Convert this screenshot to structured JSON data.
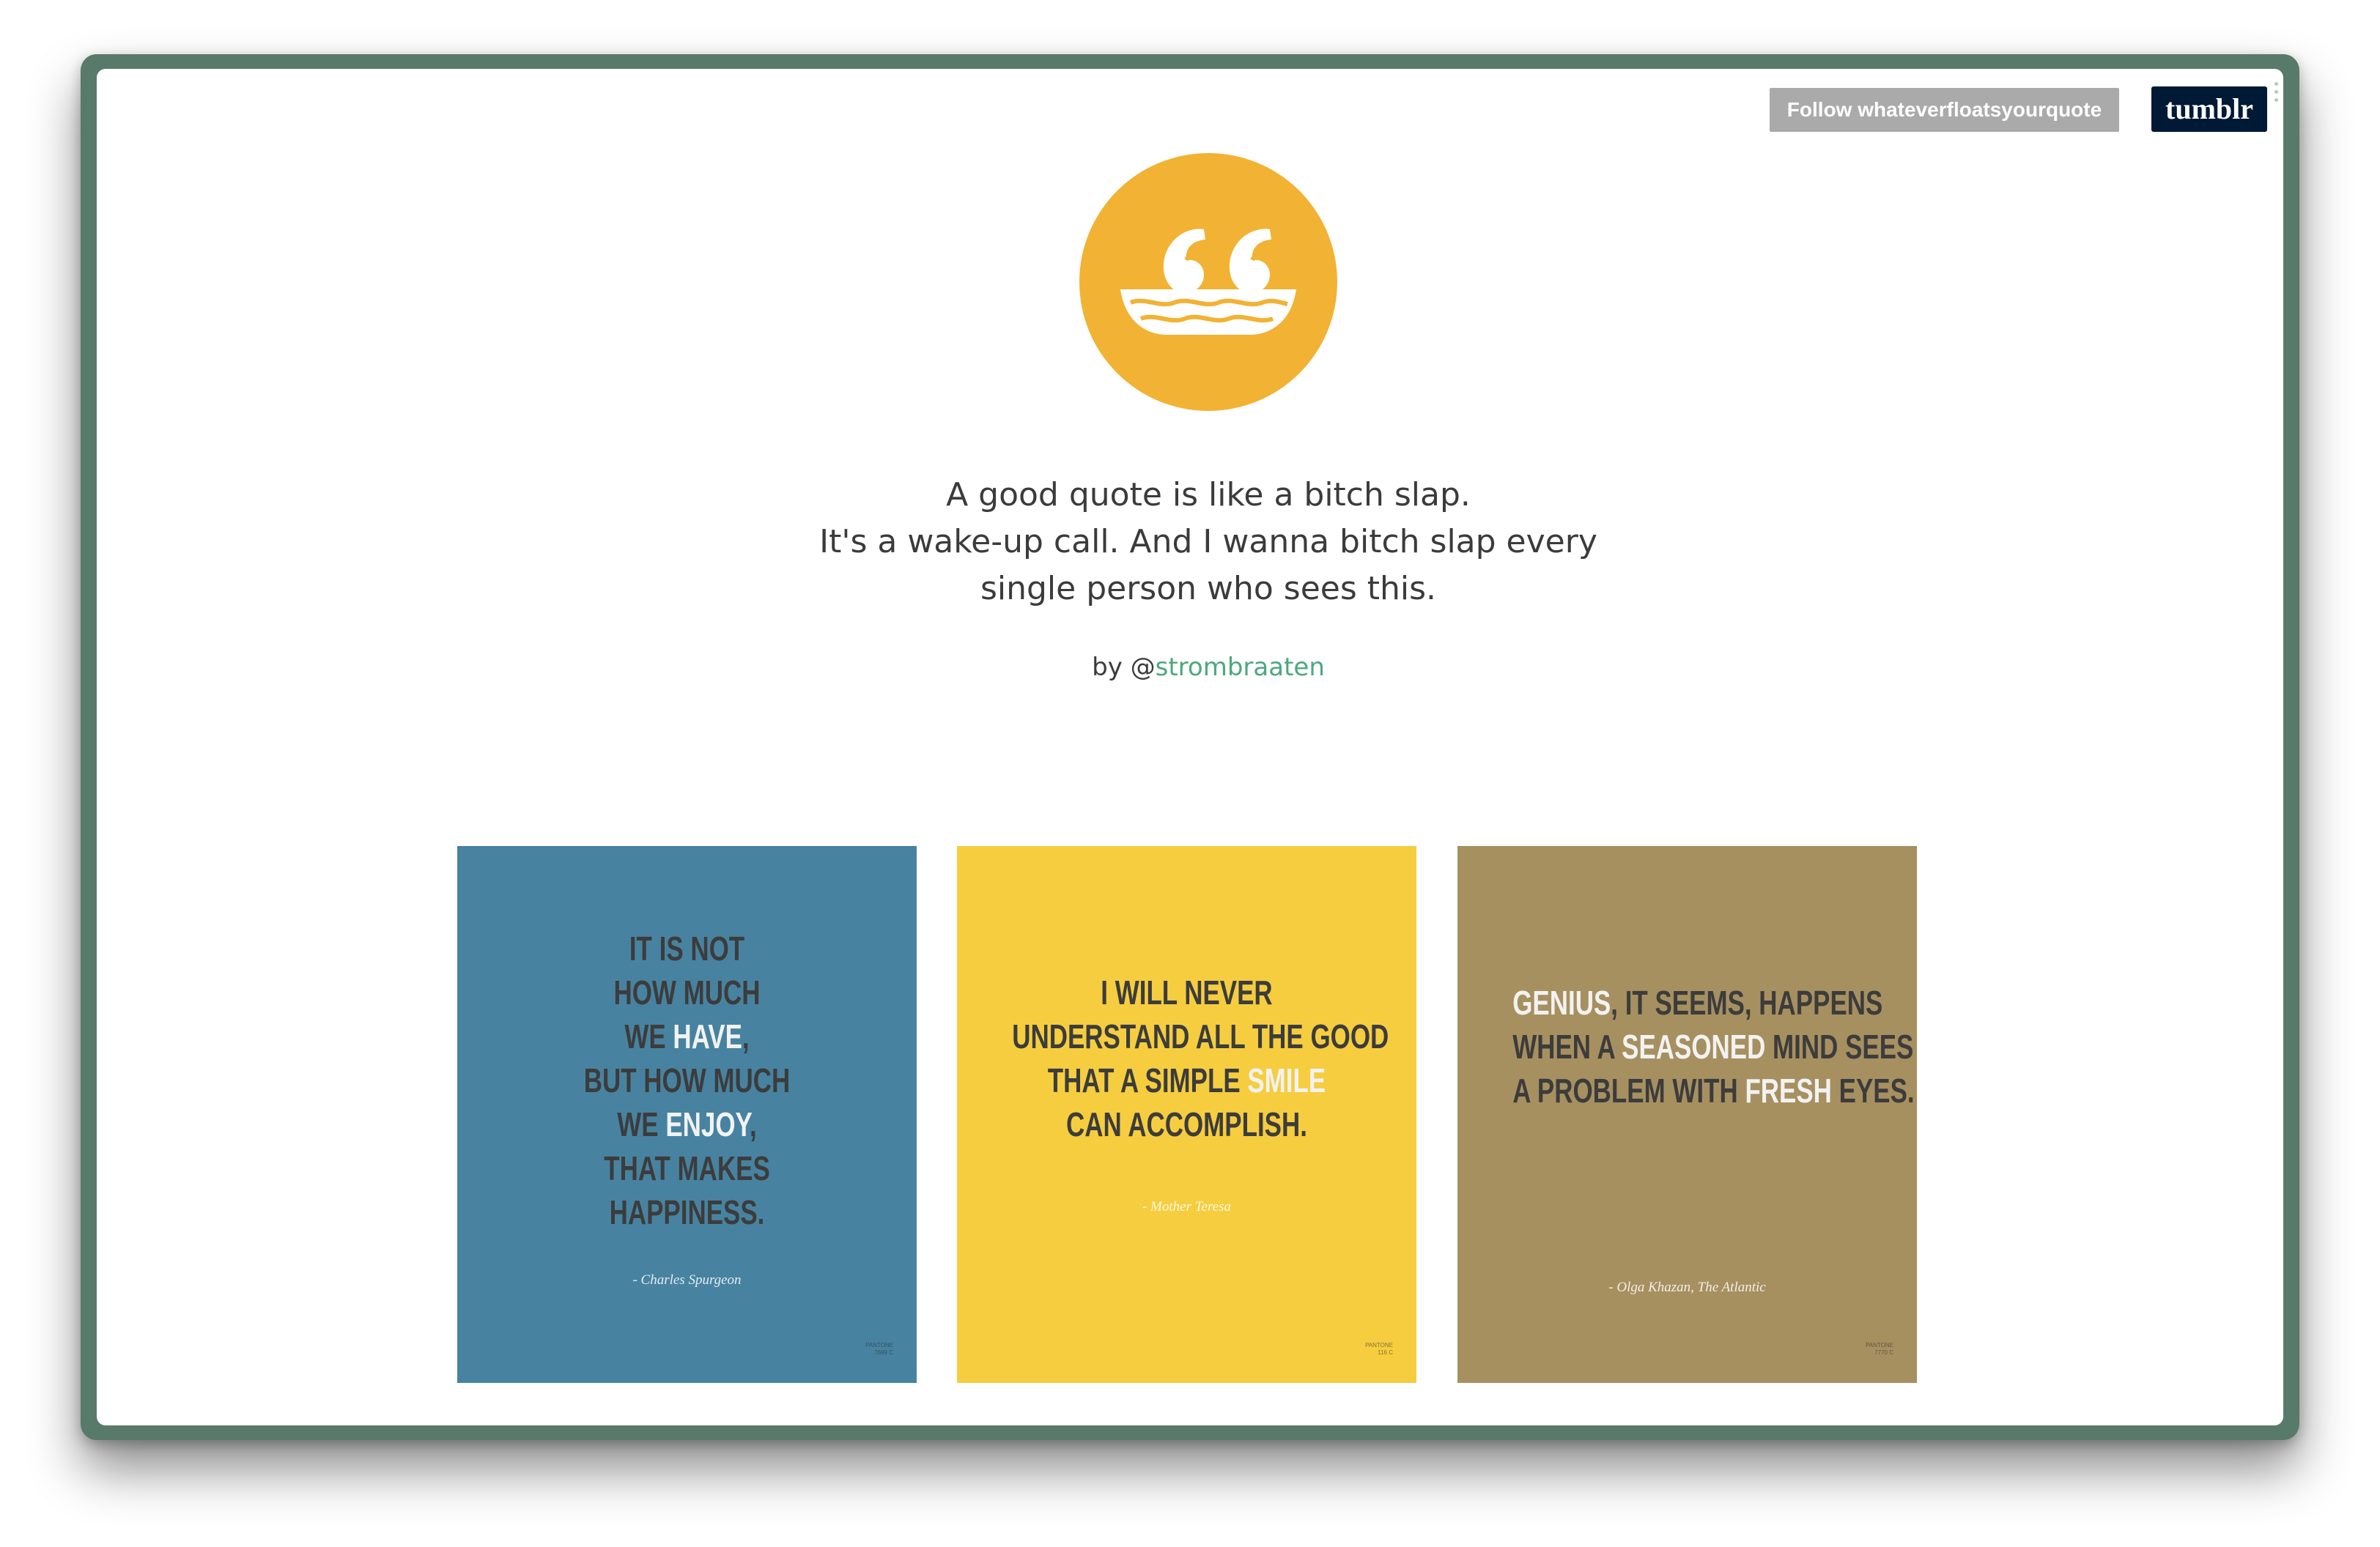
{
  "header": {
    "follow_label": "Follow whateverfloatsyourquote",
    "tumblr_label": "tumblr"
  },
  "logo": {
    "icon": "quote-boat-icon",
    "color": "#f2b233"
  },
  "intro": {
    "lines": [
      "A good quote is like a bitch slap.",
      "It's a wake-up call. And I wanna bitch slap every",
      "single person who sees this."
    ],
    "by_prefix": "by @",
    "author_handle": "strombraaten"
  },
  "cards": [
    {
      "background": "#4783a0",
      "lines": [
        [
          "IT IS NOT"
        ],
        [
          "HOW MUCH"
        ],
        [
          "WE ",
          "HAVE",
          ","
        ],
        [
          "BUT HOW MUCH"
        ],
        [
          "WE ",
          "ENJOY",
          ","
        ],
        [
          "THAT MAKES"
        ],
        [
          "HAPPINESS."
        ]
      ],
      "attribution": "- Charles Spurgeon",
      "corner": [
        "PANTONE",
        "7699 C"
      ]
    },
    {
      "background": "#f5cd3f",
      "lines": [
        [
          "I WILL NEVER"
        ],
        [
          "UNDERSTAND ALL THE GOOD"
        ],
        [
          "THAT A SIMPLE ",
          "SMILE"
        ],
        [
          "CAN ACCOMPLISH."
        ]
      ],
      "attribution": "- Mother Teresa",
      "corner": [
        "PANTONE",
        "116 C"
      ]
    },
    {
      "background": "#a79060",
      "lines": [
        [
          "",
          "GENIUS",
          ", IT SEEMS, HAPPENS"
        ],
        [
          "WHEN A ",
          "SEASONED",
          " MIND SEES"
        ],
        [
          "A PROBLEM WITH ",
          "FRESH",
          " EYES."
        ]
      ],
      "attribution": "- Olga Khazan, The Atlantic",
      "corner": [
        "PANTONE",
        "7770 C"
      ]
    }
  ]
}
